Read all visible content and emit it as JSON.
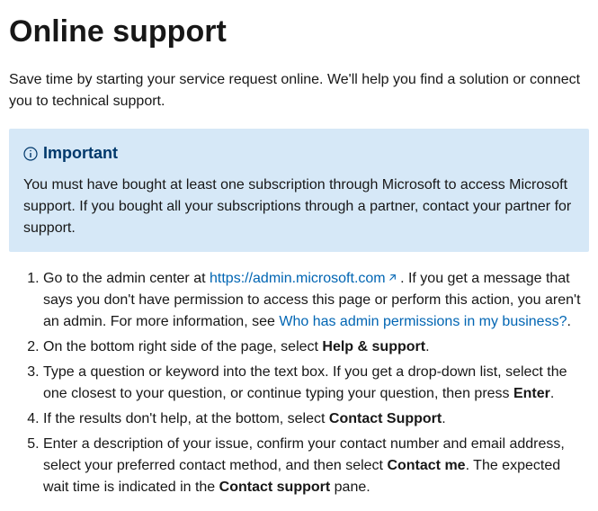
{
  "title": "Online support",
  "intro": "Save time by starting your service request online. We'll help you find a solution or connect you to technical support.",
  "note": {
    "title": "Important",
    "body": "You must have bought at least one subscription through Microsoft to access Microsoft support. If you bought all your subscriptions through a partner, contact your partner for support."
  },
  "steps": {
    "s1a": "Go to the admin center at ",
    "s1_link": "https://admin.microsoft.com",
    "s1b": " . If you get a message that says you don't have permission to access this page or perform this action, you aren't an admin. For more information, see ",
    "s1_link2": "Who has admin permissions in my business?",
    "s1c": ".",
    "s2a": "On the bottom right side of the page, select ",
    "s2_bold": "Help & support",
    "s2b": ".",
    "s3a": "Type a question or keyword into the text box. If you get a drop-down list, select the one closest to your question, or continue typing your question, then press ",
    "s3_bold": "Enter",
    "s3b": ".",
    "s4a": "If the results don't help, at the bottom, select ",
    "s4_bold": "Contact Support",
    "s4b": ".",
    "s5a": "Enter a description of your issue, confirm your contact number and email address, select your preferred contact method, and then select ",
    "s5_bold": "Contact me",
    "s5b": ". The expected wait time is indicated in the ",
    "s5_bold2": "Contact support",
    "s5c": " pane."
  }
}
